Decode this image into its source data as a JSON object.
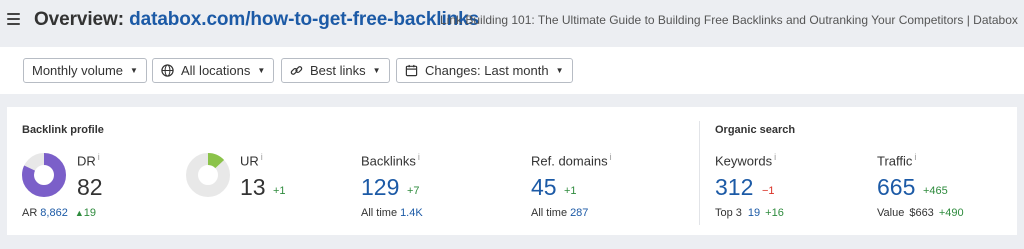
{
  "header": {
    "title_prefix": "Overview:",
    "title_url": "databox.com/how-to-get-free-backlinks",
    "page_title": "Link Building 101: The Ultimate Guide to Building Free Backlinks and Outranking Your Competitors | Databox"
  },
  "filters": [
    {
      "label": "Monthly volume",
      "icon": ""
    },
    {
      "label": "All locations",
      "icon": "globe-icon"
    },
    {
      "label": "Best links",
      "icon": "link-icon"
    },
    {
      "label": "Changes: Last month",
      "icon": "calendar-icon"
    }
  ],
  "backlink_profile": {
    "title": "Backlink profile",
    "dr": {
      "label": "DR",
      "info": "i",
      "value": "82",
      "ar_label": "AR",
      "ar_value": "8,862",
      "ar_delta": "19",
      "ring_fraction": 0.82
    },
    "ur": {
      "label": "UR",
      "info": "i",
      "value": "13",
      "delta": "+1",
      "ring_fraction": 0.13
    },
    "backlinks": {
      "label": "Backlinks",
      "info": "i",
      "value": "129",
      "delta": "+7",
      "sub_label": "All time",
      "sub_value": "1.4K"
    },
    "ref_domains": {
      "label": "Ref. domains",
      "info": "i",
      "value": "45",
      "delta": "+1",
      "sub_label": "All time",
      "sub_value": "287"
    }
  },
  "organic_search": {
    "title": "Organic search",
    "keywords": {
      "label": "Keywords",
      "info": "i",
      "value": "312",
      "delta": "−1",
      "sub_label": "Top 3",
      "sub_value": "19",
      "sub_delta": "+16"
    },
    "traffic": {
      "label": "Traffic",
      "info": "i",
      "value": "665",
      "delta": "+465",
      "sub_label": "Value",
      "sub_value": "$663",
      "sub_delta": "+490"
    }
  },
  "colors": {
    "accent": "#1c5aa6",
    "dr_ring": "#7b5fc9",
    "ur_ring": "#8bc34a",
    "ring_track": "#e8e8e8",
    "positive": "#2e8b3d",
    "negative": "#d93025"
  }
}
